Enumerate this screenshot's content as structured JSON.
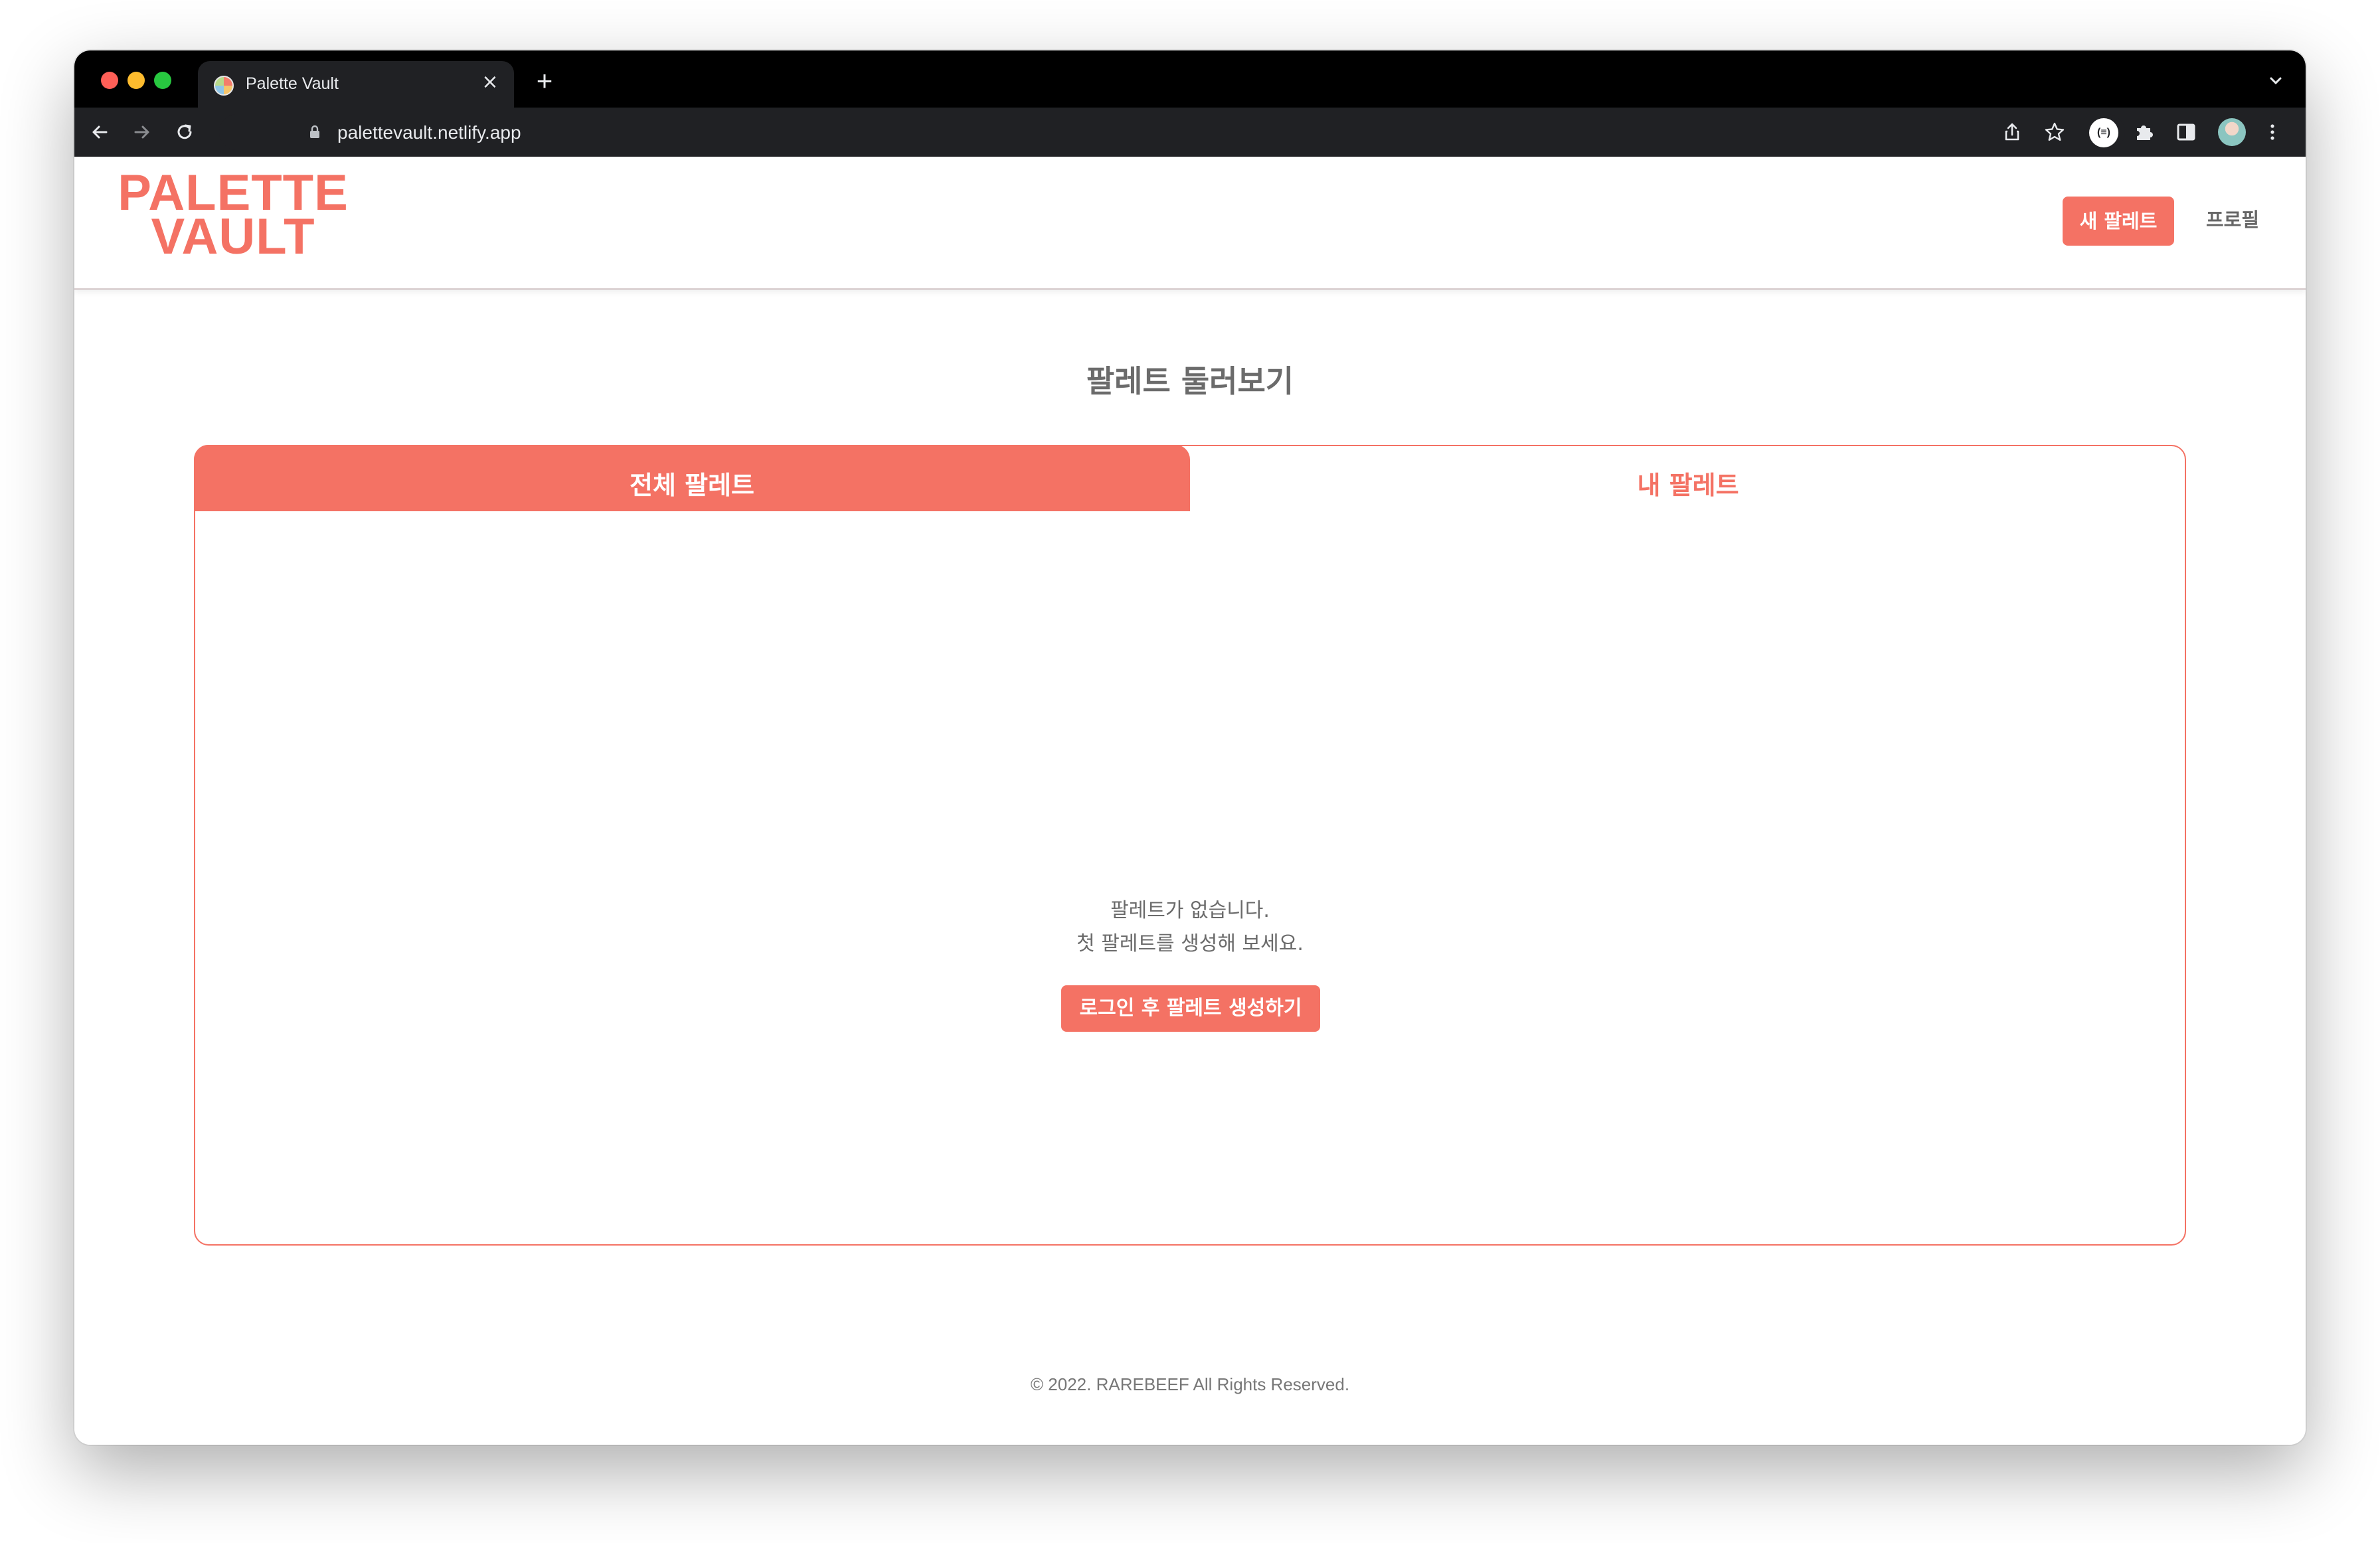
{
  "browser": {
    "tab_title": "Palette Vault",
    "url": "palettevault.netlify.app"
  },
  "header": {
    "logo_line1": "PALETTE",
    "logo_line2": "VAULT",
    "new_palette_label": "새 팔레트",
    "profile_label": "프로필"
  },
  "main": {
    "title": "팔레트 둘러보기",
    "tabs": [
      {
        "label": "전체 팔레트",
        "active": true
      },
      {
        "label": "내 팔레트",
        "active": false
      }
    ],
    "empty_line1": "팔레트가 없습니다.",
    "empty_line2": "첫 팔레트를 생성해 보세요.",
    "login_button_label": "로그인 후 팔레트 생성하기"
  },
  "footer": {
    "text": "© 2022. RAREBEEF All Rights Reserved."
  },
  "colors": {
    "accent": "#f47264",
    "text_muted": "#6b6b6b"
  }
}
